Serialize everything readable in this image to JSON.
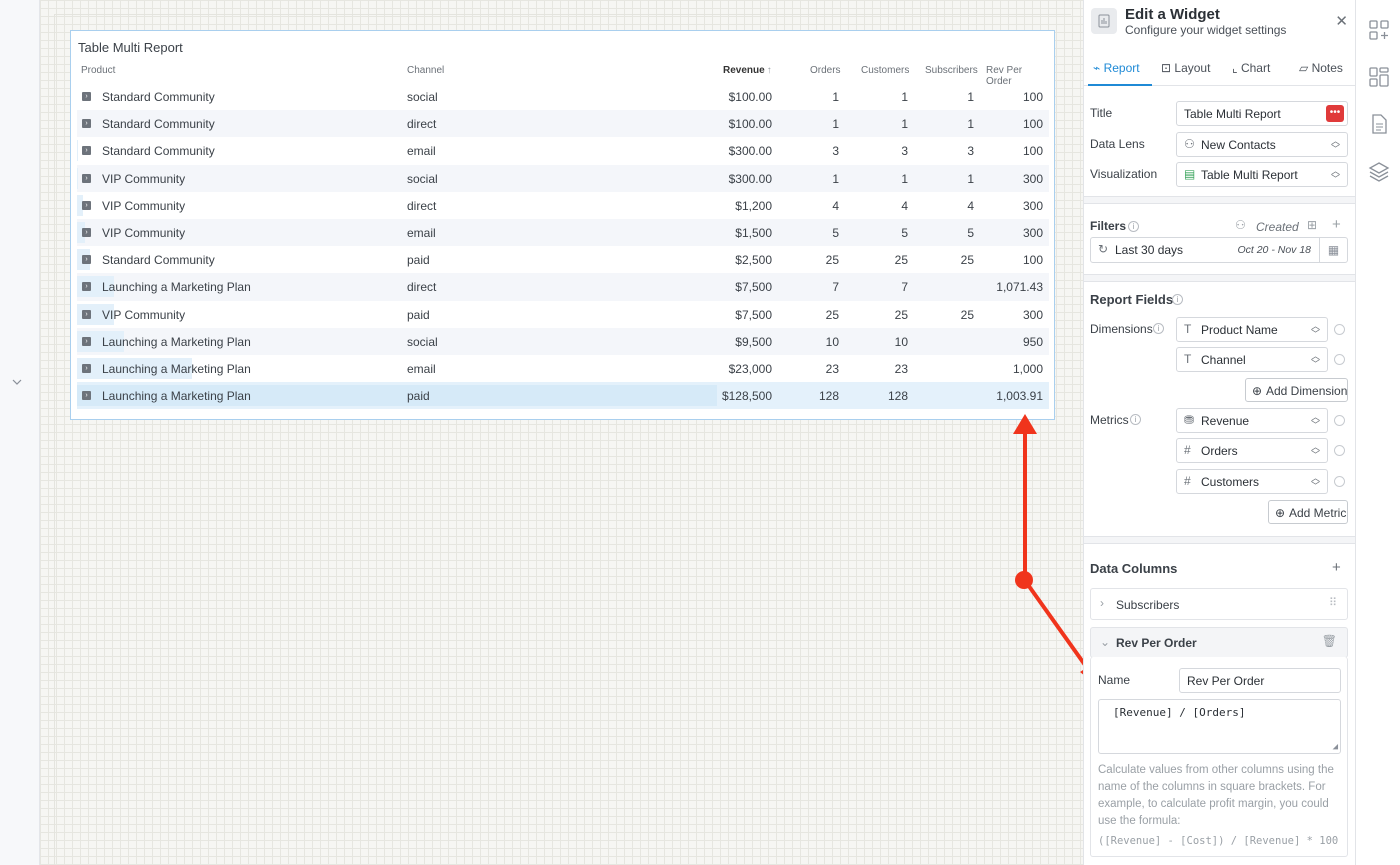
{
  "widget": {
    "title": "Table Multi Report",
    "columns": [
      "Product",
      "Channel",
      "Revenue",
      "Orders",
      "Customers",
      "Subscribers",
      "Rev Per Order"
    ],
    "sort_indicator": "↑",
    "rows": [
      {
        "product": "Standard Community",
        "channel": "social",
        "revenue": "$100.00",
        "orders": "1",
        "customers": "1",
        "subscribers": "1",
        "rpo": "100",
        "share": 0.0
      },
      {
        "product": "Standard Community",
        "channel": "direct",
        "revenue": "$100.00",
        "orders": "1",
        "customers": "1",
        "subscribers": "1",
        "rpo": "100",
        "share": 0.0
      },
      {
        "product": "Standard Community",
        "channel": "email",
        "revenue": "$300.00",
        "orders": "3",
        "customers": "3",
        "subscribers": "3",
        "rpo": "100",
        "share": 0.002
      },
      {
        "product": "VIP Community",
        "channel": "social",
        "revenue": "$300.00",
        "orders": "1",
        "customers": "1",
        "subscribers": "1",
        "rpo": "300",
        "share": 0.002
      },
      {
        "product": "VIP Community",
        "channel": "direct",
        "revenue": "$1,200",
        "orders": "4",
        "customers": "4",
        "subscribers": "4",
        "rpo": "300",
        "share": 0.009
      },
      {
        "product": "VIP Community",
        "channel": "email",
        "revenue": "$1,500",
        "orders": "5",
        "customers": "5",
        "subscribers": "5",
        "rpo": "300",
        "share": 0.012
      },
      {
        "product": "Standard Community",
        "channel": "paid",
        "revenue": "$2,500",
        "orders": "25",
        "customers": "25",
        "subscribers": "25",
        "rpo": "100",
        "share": 0.02
      },
      {
        "product": "Launching a Marketing Plan",
        "channel": "direct",
        "revenue": "$7,500",
        "orders": "7",
        "customers": "7",
        "subscribers": "",
        "rpo": "1,071.43",
        "share": 0.058
      },
      {
        "product": "VIP Community",
        "channel": "paid",
        "revenue": "$7,500",
        "orders": "25",
        "customers": "25",
        "subscribers": "25",
        "rpo": "300",
        "share": 0.058
      },
      {
        "product": "Launching a Marketing Plan",
        "channel": "social",
        "revenue": "$9,500",
        "orders": "10",
        "customers": "10",
        "subscribers": "",
        "rpo": "950",
        "share": 0.074
      },
      {
        "product": "Launching a Marketing Plan",
        "channel": "email",
        "revenue": "$23,000",
        "orders": "23",
        "customers": "23",
        "subscribers": "",
        "rpo": "1,000",
        "share": 0.179
      },
      {
        "product": "Launching a Marketing Plan",
        "channel": "paid",
        "revenue": "$128,500",
        "orders": "128",
        "customers": "128",
        "subscribers": "",
        "rpo": "1,003.91",
        "share": 1.0
      }
    ]
  },
  "panel": {
    "title": "Edit a Widget",
    "subtitle": "Configure your widget settings",
    "tabs": [
      "Report",
      "Layout",
      "Chart",
      "Notes"
    ],
    "title_label": "Title",
    "title_value": "Table Multi Report",
    "data_lens_label": "Data Lens",
    "data_lens_value": "New Contacts",
    "visualization_label": "Visualization",
    "visualization_value": "Table Multi Report",
    "filters_label": "Filters",
    "filters_created": "Created",
    "filter_range": "Last 30 days",
    "filter_dates": "Oct 20 - Nov 18",
    "report_fields_label": "Report Fields",
    "dimensions_label": "Dimensions",
    "dimensions": [
      "Product Name",
      "Channel"
    ],
    "add_dimension": "Add Dimension",
    "metrics_label": "Metrics",
    "metrics": [
      "Revenue",
      "Orders",
      "Customers"
    ],
    "add_metric": "Add Metric",
    "data_columns_label": "Data Columns",
    "data_columns": [
      "Subscribers",
      "Rev Per Order"
    ],
    "name_label": "Name",
    "name_value": "Rev Per Order",
    "formula": "[Revenue] / [Orders]",
    "hint": "Calculate values from other columns using the name of the columns in square brackets. For example, to calculate profit margin, you could use the formula:",
    "hint_formula": "([Revenue] - [Cost]) / [Revenue] * 100"
  },
  "colors": {
    "accent": "#1f8ad6",
    "annotation": "#f0341c",
    "danger": "#e03a3a"
  }
}
